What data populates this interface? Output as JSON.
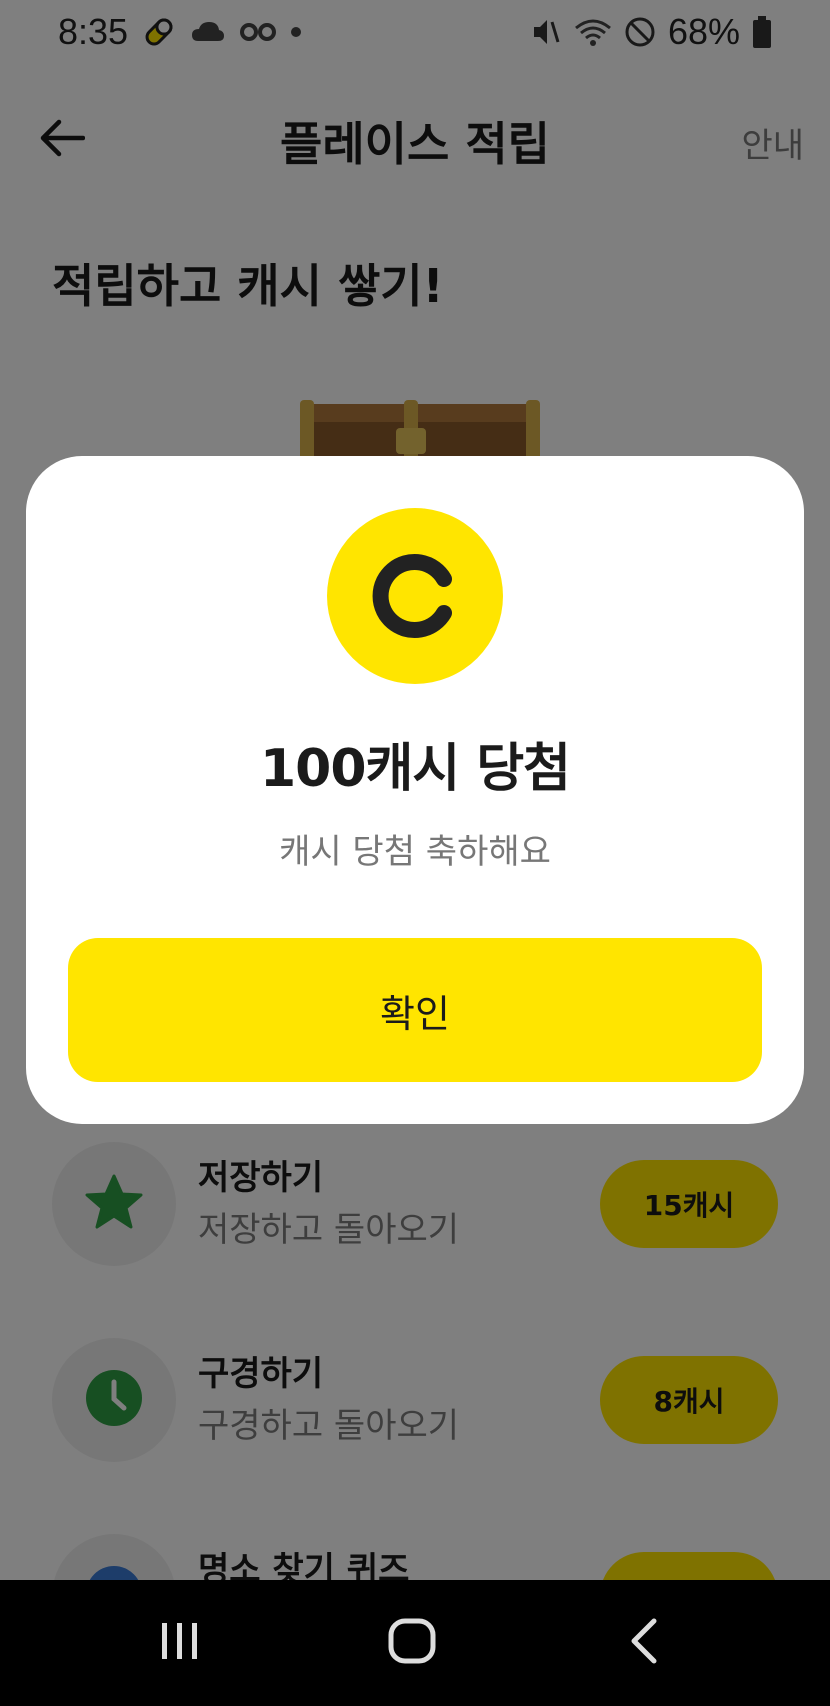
{
  "status_bar": {
    "time": "8:35",
    "battery_percent": "68%",
    "icons": [
      "pill-icon",
      "cloud-icon",
      "voicemail-icon",
      "dot-icon",
      "mute-icon",
      "wifi-icon",
      "do-not-disturb-icon",
      "battery-icon"
    ]
  },
  "header": {
    "title": "플레이스 적립",
    "info_label": "안내",
    "back_icon": "arrow-left-icon"
  },
  "page": {
    "headline": "적립하고 캐시 쌓기!"
  },
  "tasks": [
    {
      "title": "저장하기",
      "subtitle": "저장하고 돌아오기",
      "reward": "15캐시",
      "icon": "star-icon"
    },
    {
      "title": "구경하기",
      "subtitle": "구경하고 돌아오기",
      "reward": "8캐시",
      "icon": "clock-icon"
    },
    {
      "title": "명소 찾기 퀴즈",
      "subtitle": "",
      "reward": "",
      "icon": "quiz-icon"
    }
  ],
  "modal": {
    "title": "100캐시 당첨",
    "subtitle": "캐시 당첨 축하해요",
    "confirm_label": "확인",
    "coin_icon": "cash-coin-icon"
  },
  "colors": {
    "accent_yellow": "#ffe500",
    "green_icon": "#2e9e44",
    "overlay": "rgba(0,0,0,0.5)"
  },
  "navigation_bar": {
    "buttons": [
      "recent-apps-icon",
      "home-icon",
      "back-icon"
    ]
  }
}
